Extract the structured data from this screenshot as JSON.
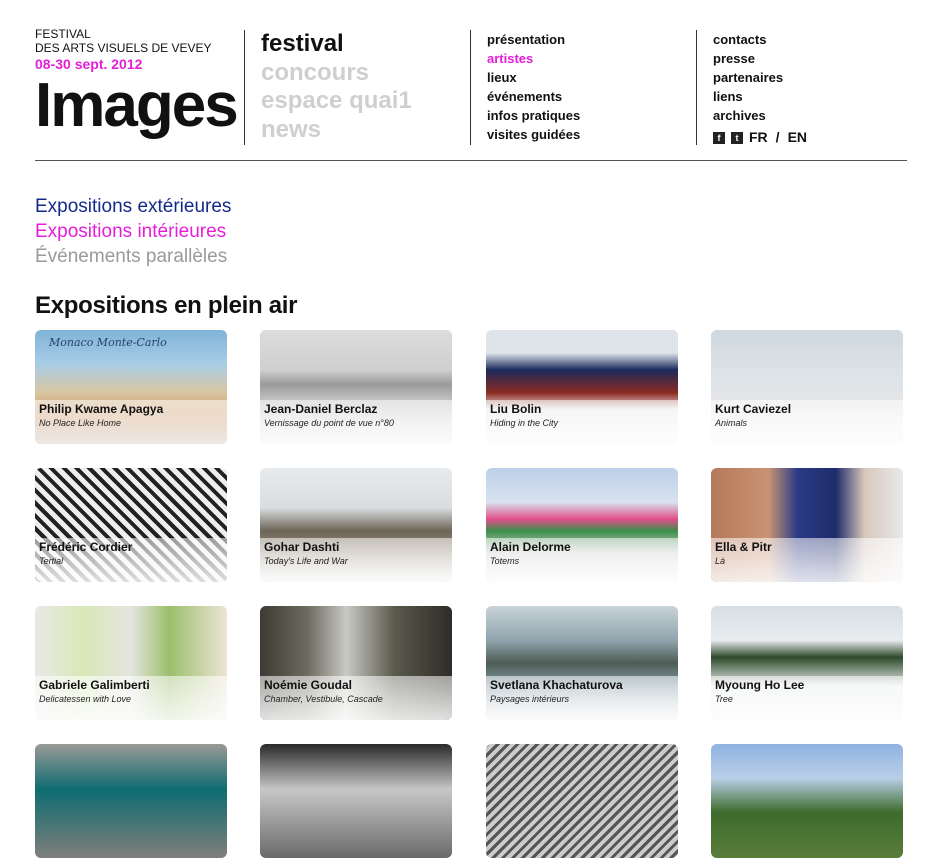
{
  "brand": {
    "line1": "FESTIVAL",
    "line2": "DES ARTS VISUELS DE VEVEY",
    "dates": "08-30 sept. 2012",
    "logo": "Images",
    "accent": "#e61ed9"
  },
  "main_nav": [
    {
      "label": "festival",
      "active": true
    },
    {
      "label": "concours",
      "active": false
    },
    {
      "label": "espace quai1",
      "active": false
    },
    {
      "label": "news",
      "active": false
    }
  ],
  "sub_nav": [
    {
      "label": "présentation",
      "active": false
    },
    {
      "label": "artistes",
      "active": true
    },
    {
      "label": "lieux",
      "active": false
    },
    {
      "label": "événements",
      "active": false
    },
    {
      "label": "infos pratiques",
      "active": false
    },
    {
      "label": "visites guidées",
      "active": false
    }
  ],
  "right_nav": [
    {
      "label": "contacts"
    },
    {
      "label": "presse"
    },
    {
      "label": "partenaires"
    },
    {
      "label": "liens"
    },
    {
      "label": "archives"
    }
  ],
  "social": {
    "facebook_icon": "f",
    "twitter_icon": "t"
  },
  "lang": {
    "fr": "FR",
    "sep": "/",
    "en": "EN"
  },
  "categories": {
    "exterieures": "Expositions extérieures",
    "interieures": "Expositions intérieures",
    "paralleles": "Événements parallèles",
    "colors": {
      "ext": "#142a8a",
      "int": "#e61ed9",
      "par": "#9a9a9a"
    }
  },
  "section_title": "Expositions en plein air",
  "artists": [
    {
      "name": "Philip Kwame Apagya",
      "work": "No Place Like Home",
      "img_bg": "linear-gradient(180deg,#7fb3d8 0%,#a8cde6 30%,#d9c6a0 55%,#c98c5a 80%,#8a6f4f 100%)",
      "top_text": "Monaco  Monte-Carlo"
    },
    {
      "name": "Jean-Daniel Berclaz",
      "work": "Vernissage du point de vue n°80",
      "img_bg": "linear-gradient(180deg,#dcdcdc 0%,#cfcfcf 35%,#9a9a9a 48%,#bfbfbf 60%,#e6e6e6 100%)",
      "top_text": ""
    },
    {
      "name": "Liu Bolin",
      "work": "Hiding in the City",
      "img_bg": "linear-gradient(180deg,#dfe4ea 0%,#dfe4ea 20%,#1d2a5c 35%,#8b2a22 55%,#e7e7e7 70%,#f1f1f1 100%)",
      "top_text": ""
    },
    {
      "name": "Kurt Caviezel",
      "work": "Animals",
      "img_bg": "linear-gradient(180deg,#cfd8df 0%,#dde3e8 40%,#e6e6e6 70%,#f2f2f2 100%)",
      "top_text": ""
    },
    {
      "name": "Frédéric Cordier",
      "work": "Tertial",
      "img_bg": "repeating-linear-gradient(45deg,#222 0 4px,#eee 4px 9px)",
      "top_text": ""
    },
    {
      "name": "Gohar Dashti",
      "work": "Today's Life and War",
      "img_bg": "linear-gradient(180deg,#e8ebee 0%,#d9dde0 35%,#6d6558 55%,#9b8f7c 75%,#e0e0e0 100%)",
      "top_text": ""
    },
    {
      "name": "Alain Delorme",
      "work": "Totems",
      "img_bg": "linear-gradient(180deg,#bcd0ea 0%,#d8e2ee 30%,#e04e8a 45%,#3c8f4a 55%,#cfcfcf 75%,#eee 100%)",
      "top_text": ""
    },
    {
      "name": "Ella & Pitr",
      "work": "Là",
      "img_bg": "linear-gradient(90deg,#b57a5a 0%,#c99373 30%,#2a3a86 45%,#1f2c6b 65%,#d8c7bb 80%,#e9e9e9 100%)",
      "top_text": ""
    },
    {
      "name": "Gabriele Galimberti",
      "work": "Delicatessen with Love",
      "img_bg": "linear-gradient(90deg,#e9e9e6 0%,#d8e8b8 25%,#e5e5df 50%,#9bbf6c 70%,#ede4d5 100%)",
      "top_text": ""
    },
    {
      "name": "Noémie Goudal",
      "work": "Chamber, Vestibule, Cascade",
      "img_bg": "linear-gradient(90deg,#3c3a33 0%,#6f6c60 25%,#c9c9c5 45%,#5a5a4d 70%,#2e2c27 100%)",
      "top_text": ""
    },
    {
      "name": "Svetlana Khachaturova",
      "work": "Paysages intérieurs",
      "img_bg": "linear-gradient(180deg,#c9d3d8 0%,#8fa5ae 30%,#4f5c55 50%,#7f99a3 70%,#e2e2e2 100%)",
      "top_text": ""
    },
    {
      "name": "Myoung Ho Lee",
      "work": "Tree",
      "img_bg": "linear-gradient(180deg,#d7dee3 0%,#e8ecef 30%,#2d4a2a 45%,#e7eaec 70%,#f2f2f2 100%)",
      "top_text": ""
    },
    {
      "name": "",
      "work": "",
      "img_bg": "linear-gradient(180deg,#9a9a96 0%,#0e6c72 40%,#7f7f7a 100%)",
      "top_text": ""
    },
    {
      "name": "",
      "work": "",
      "img_bg": "linear-gradient(180deg,#2a2a2a 0%,#c7c7c7 40%,#6a6a6a 100%)",
      "top_text": ""
    },
    {
      "name": "",
      "work": "",
      "img_bg": "repeating-linear-gradient(135deg,#555 0 3px,#ccc 3px 7px)",
      "top_text": ""
    },
    {
      "name": "",
      "work": "",
      "img_bg": "linear-gradient(180deg,#8fb2e0 0%,#b9cfe8 30%,#3d6b2b 60%,#5a7d3a 100%)",
      "top_text": ""
    }
  ]
}
